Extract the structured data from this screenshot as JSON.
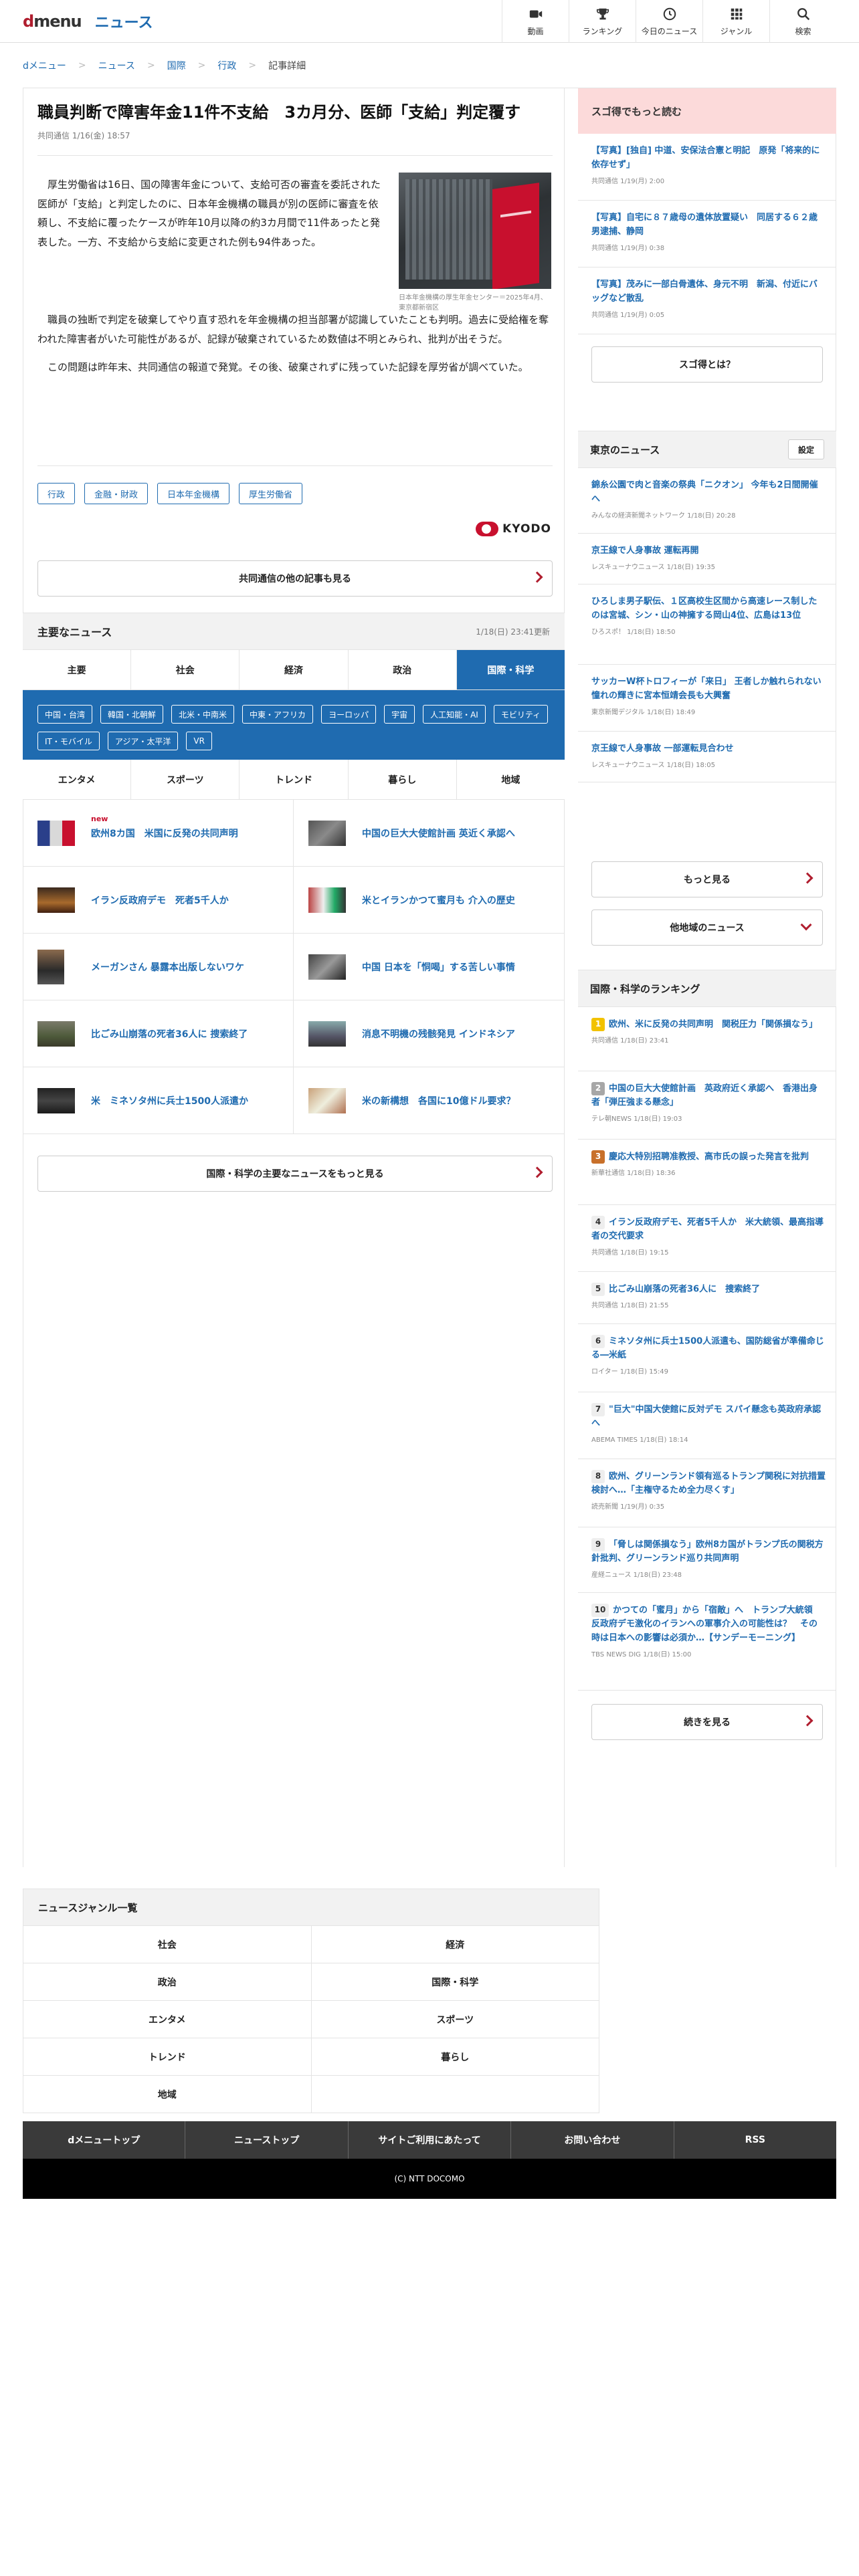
{
  "header": {
    "logo_main": "d",
    "logo_rest": "menu",
    "service": "ニュース",
    "nav": [
      {
        "label": "動画",
        "icon": "video-icon"
      },
      {
        "label": "ランキング",
        "icon": "trophy-icon"
      },
      {
        "label": "今日のニュース",
        "icon": "clock-icon"
      },
      {
        "label": "ジャンル",
        "icon": "grid-icon"
      },
      {
        "label": "検索",
        "icon": "search-icon"
      }
    ]
  },
  "breadcrumb": [
    "dメニュー",
    "ニュース",
    "国際",
    "行政",
    "記事詳細"
  ],
  "article": {
    "title": "職員判断で障害年金11件不支給　3カ月分、医師「支給」判定覆す",
    "meta": "共同通信 1/16(金) 18:57",
    "p1": "厚生労働省は16日、国の障害年金について、支給可否の審査を委託された医師が「支給」と判定したのに、日本年金機構の職員が別の医師に審査を依頼し、不支給に覆ったケースが昨年10月以降の約3カ月間で11件あったと発表した。一方、不支給から支給に変更された例も94件あった。",
    "p2": "職員の独断で判定を破棄してやり直す恐れを年金機構の担当部署が認識していたことも判明。過去に受給権を奪われた障害者がいた可能性があるが、記録が破棄されているため数値は不明とみられ、批判が出そうだ。",
    "p3": "この問題は昨年末、共同通信の報道で発覚。その後、破棄されずに残っていた記録を厚労省が調べていた。",
    "image_caption": "日本年金機構の厚生年金センター＝2025年4月、東京都新宿区",
    "tags": [
      "行政",
      "金融・財政",
      "日本年金機構",
      "厚生労働省"
    ],
    "source_logo": "KYODO",
    "more_label": "共同通信の他の記事も見る"
  },
  "major": {
    "title": "主要なニュース",
    "updated": "1/18(日) 23:41更新",
    "tabs1": [
      "主要",
      "社会",
      "経済",
      "政治",
      "国際・科学"
    ],
    "subtags": [
      "中国・台湾",
      "韓国・北朝鮮",
      "北米・中南米",
      "中東・アフリカ",
      "ヨーロッパ",
      "宇宙",
      "人工知能・AI",
      "モビリティ",
      "IT・モバイル",
      "アジア・太平洋",
      "VR"
    ],
    "tabs2": [
      "エンタメ",
      "スポーツ",
      "トレンド",
      "暮らし",
      "地域"
    ],
    "new_label": "new",
    "items": [
      "欧州8カ国　米国に反発の共同声明",
      "中国の巨大大使館計画 英近く承認へ",
      "イラン反政府デモ　死者5千人か",
      "米とイランかつて蜜月も 介入の歴史",
      "メーガンさん 暴露本出版しないワケ",
      "中国 日本を「恫喝」する苦しい事情",
      "比ごみ山崩落の死者36人に 捜索終了",
      "消息不明機の残骸発見 インドネシア",
      "米　ミネソタ州に兵士1500人派遣か",
      "米の新構想　各国に10億ドル要求？"
    ],
    "more_label": "国際・科学の主要なニュースをもっと見る"
  },
  "sugotoku": {
    "title": "スゴ得でもっと読む",
    "items": [
      {
        "text": "【写真】[独自] 中道、安保法合憲と明記　原発「将来的に依存せず」",
        "meta": "共同通信 1/19(月) 2:00"
      },
      {
        "text": "【写真】自宅に８７歳母の遺体放置疑い　同居する６２歳男逮捕、静岡",
        "meta": "共同通信 1/19(月) 0:38"
      },
      {
        "text": "【写真】茂みに一部白骨遺体、身元不明　新潟、付近にバッグなど散乱",
        "meta": "共同通信 1/19(月) 0:05"
      }
    ],
    "what_label": "スゴ得とは？"
  },
  "tokyo": {
    "title": "東京のニュース",
    "settings_label": "設定",
    "items": [
      {
        "text": "錦糸公園で肉と音楽の祭典「ニクオン」 今年も2日間開催へ",
        "meta": "みんなの経済新聞ネットワーク 1/18(日) 20:28"
      },
      {
        "text": "京王線で人身事故 運転再開",
        "meta": "レスキューナウニュース 1/18(日) 19:35"
      },
      {
        "text": "ひろしま男子駅伝、１区高校生区間から高速レース制したのは宮城、シン・山の神擁する岡山4位、広島は13位",
        "meta": "ひろスポ！ 1/18(日) 18:50"
      },
      {
        "text": "サッカーW杯トロフィーが「来日」 王者しか触れられない憧れの輝きに宮本恒靖会長も大興奮",
        "meta": "東京新聞デジタル 1/18(日) 18:49"
      },
      {
        "text": "京王線で人身事故 一部運転見合わせ",
        "meta": "レスキューナウニュース 1/18(日) 18:05"
      }
    ],
    "more_label": "もっと見る",
    "other_label": "他地域のニュース"
  },
  "ranking": {
    "title": "国際・科学のランキング",
    "items": [
      {
        "num": "1",
        "text": "欧州、米に反発の共同声明　関税圧力「関係損なう」",
        "meta": "共同通信 1/18(日) 23:41"
      },
      {
        "num": "2",
        "text": "中国の巨大大使館計画　英政府近く承認へ　香港出身者「弾圧強まる懸念」",
        "meta": "テレ朝NEWS 1/18(日) 19:03"
      },
      {
        "num": "3",
        "text": "慶応大特別招聘准教授、高市氏の誤った発言を批判",
        "meta": "新華社通信 1/18(日) 18:36"
      },
      {
        "num": "4",
        "text": "イラン反政府デモ、死者5千人か　米大統領、最高指導者の交代要求",
        "meta": "共同通信 1/18(日) 19:15"
      },
      {
        "num": "5",
        "text": "比ごみ山崩落の死者36人に　捜索終了",
        "meta": "共同通信 1/18(日) 21:55"
      },
      {
        "num": "6",
        "text": "ミネソタ州に兵士1500人派遣も、国防総省が準備命じる―米紙",
        "meta": "ロイター 1/18(日) 15:49"
      },
      {
        "num": "7",
        "text": "\"巨大\"中国大使館に反対デモ スパイ懸念も英政府承認へ",
        "meta": "ABEMA TIMES 1/18(日) 18:14"
      },
      {
        "num": "8",
        "text": "欧州、グリーンランド領有巡るトランプ関税に対抗措置検討へ…「主権守るため全力尽くす」",
        "meta": "読売新聞 1/19(月) 0:35"
      },
      {
        "num": "9",
        "text": "「脅しは関係損なう」欧州8カ国がトランプ氏の関税方針批判、グリーンランド巡り共同声明",
        "meta": "産経ニュース 1/18(日) 23:48"
      },
      {
        "num": "10",
        "text": "かつての「蜜月」から「宿敵」へ　トランプ大統領　反政府デモ激化のイランへの軍事介入の可能性は？　その時は日本への影響は必須か…【サンデーモーニング】",
        "meta": "TBS NEWS DIG 1/18(日) 15:00"
      }
    ],
    "more_label": "続きを見る"
  },
  "genre": {
    "title": "ニュースジャンル一覧",
    "items": [
      "社会",
      "経済",
      "政治",
      "国際・科学",
      "エンタメ",
      "スポーツ",
      "トレンド",
      "暮らし",
      "地域"
    ]
  },
  "footer": {
    "links": [
      "dメニュートップ",
      "ニューストップ",
      "サイトご利用にあたって",
      "お問い合わせ",
      "RSS"
    ],
    "copyright": "(C) NTT DOCOMO"
  },
  "colors": {
    "brand_red": "#b01e2f",
    "link_blue": "#1f6bb0",
    "rank_gold": "#f2c200",
    "rank_silver": "#a7a7a7",
    "rank_bronze": "#c8702a"
  }
}
